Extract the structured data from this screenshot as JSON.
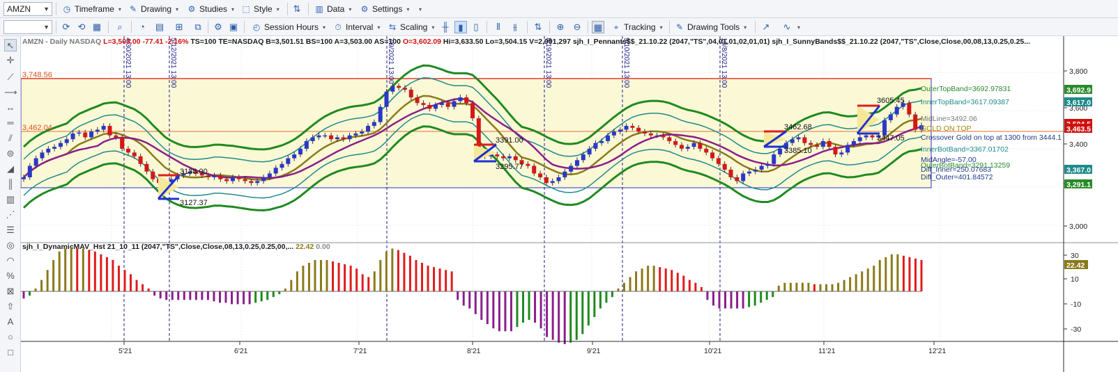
{
  "toolbar1": {
    "symbol": "AMZN",
    "items": [
      {
        "label": "Timeframe",
        "icon": "clock-icon"
      },
      {
        "label": "Drawing",
        "icon": "pencil-icon"
      },
      {
        "label": "Studies",
        "icon": "gear-icon"
      },
      {
        "label": "Style",
        "icon": "style-icon"
      },
      {
        "label": "Data",
        "icon": "bar-chart-icon"
      },
      {
        "label": "Settings",
        "icon": "settings-icon"
      }
    ]
  },
  "toolbar2": {
    "interval_value": "",
    "items": [
      {
        "label": "Session Hours",
        "icon": "session-icon"
      },
      {
        "label": "Interval",
        "icon": "interval-icon"
      },
      {
        "label": "Scaling",
        "icon": "scaling-icon"
      },
      {
        "label": "Tracking",
        "icon": "tracking-icon"
      },
      {
        "label": "Drawing Tools",
        "icon": "drawing-tools-icon"
      }
    ]
  },
  "price_header": {
    "symbol_text": "AMZN - Daily  NASDAQ",
    "last": "L=3,503.00",
    "change": "-77.41",
    "change_pct": "-2.16%",
    "rest": "TS=100  TE=NASDAQ  B=3,501.51  BS=100  A=3,503.00  AS=100",
    "open": "O=3,602.09",
    "ohlc_rest": "Hi=3,633.50  Lo=3,504.15  V=2,991,297",
    "study1": "sjh_I_Pennants$$_21.10.22 (2047,\"TS\",04,01,01,02,01,01)",
    "study2": "sjh_I_SunnyBands$$_21.10.22 (2047,\"TS\",Close,Close,00,08,13,0.25,0.25..."
  },
  "indicator_header": {
    "name": "sjh_I_DynamicMAV_Hst 21_10_11 (2047,\"TS\",Close,Close,08,13,0.25,0.25,00,...",
    "v1": "22.42",
    "v2": "0.00"
  },
  "levels": {
    "top": "3,748.56",
    "mid": "3,462.04"
  },
  "vlines": [
    "4/30/2021 13:00",
    "5/12/2021 13:00",
    "7/9/2021 13:00",
    "8/19/2021 13:00",
    "9/10/2021 13:00",
    "10/8/2021 13:00"
  ],
  "price_labels": [
    {
      "text": "3138.00"
    },
    {
      "text": "3127.37"
    },
    {
      "text": "3391.00"
    },
    {
      "text": "3295.77"
    },
    {
      "text": "3462.68"
    },
    {
      "text": "3385.10"
    },
    {
      "text": "3447.05"
    },
    {
      "text": "3605.45"
    }
  ],
  "right_labels": [
    {
      "text": "OuterTopBand=3692.97831",
      "color": "#2a8a2a"
    },
    {
      "text": "InnerTopBand=3617.09387",
      "color": "#1f8a8a"
    },
    {
      "text": "MidLine=3492.06",
      "color": "#777777"
    },
    {
      "text": "GOLD ON TOP",
      "color": "#a08a10"
    },
    {
      "text": "Crossover Gold on top at 1300 from 3444.1",
      "color": "#1e3a8a"
    },
    {
      "text": "InnerBotBand=3367.01702",
      "color": "#1f8a8a"
    },
    {
      "text": "MidAngle=-57.00",
      "color": "#1e3a8a"
    },
    {
      "text": "OuterBotBand=3291.13259",
      "color": "#2a8a2a"
    },
    {
      "text": "Diff_Inner=250.07683",
      "color": "#1e3a8a"
    },
    {
      "text": "Diff_Outer=401.84572",
      "color": "#1e3a8a"
    }
  ],
  "price_axis": [
    "3,800",
    "3,600",
    "3,400",
    "3,200",
    "3,000"
  ],
  "price_tags": [
    {
      "text": "3,692.9",
      "color": "#2a8a2a"
    },
    {
      "text": "3,617.0",
      "color": "#1f8a8a"
    },
    {
      "text": "3,504.5",
      "color": "#d01010"
    },
    {
      "text": "3,463.5",
      "color": "#d01010"
    },
    {
      "text": "3,367.0",
      "color": "#1f8a8a"
    },
    {
      "text": "3,291.1",
      "color": "#2a8a2a"
    }
  ],
  "ind_axis": [
    "30",
    "10",
    "-10",
    "-30"
  ],
  "ind_tag": {
    "text": "22.42",
    "color": "#8a7a1a"
  },
  "x_axis": [
    "5'21",
    "6'21",
    "7'21",
    "8'21",
    "9'21",
    "10'21",
    "11'21",
    "12'21"
  ],
  "chart_data": {
    "type": "candlestick",
    "ylim": [
      2920,
      3840
    ],
    "close_last": 3503.0,
    "closes": [
      3230,
      3290,
      3330,
      3360,
      3380,
      3390,
      3410,
      3430,
      3460,
      3465,
      3440,
      3470,
      3480,
      3500,
      3450,
      3440,
      3380,
      3360,
      3340,
      3300,
      3260,
      3220,
      3200,
      3190,
      3220,
      3240,
      3250,
      3260,
      3250,
      3240,
      3230,
      3240,
      3220,
      3210,
      3230,
      3220,
      3210,
      3200,
      3210,
      3230,
      3250,
      3280,
      3300,
      3330,
      3350,
      3380,
      3420,
      3440,
      3450,
      3450,
      3430,
      3440,
      3430,
      3450,
      3460,
      3470,
      3500,
      3520,
      3600,
      3680,
      3710,
      3700,
      3690,
      3650,
      3620,
      3610,
      3590,
      3610,
      3620,
      3600,
      3630,
      3650,
      3620,
      3540,
      3360,
      3340,
      3350,
      3340,
      3330,
      3340,
      3320,
      3300,
      3290,
      3250,
      3230,
      3200,
      3210,
      3230,
      3260,
      3290,
      3320,
      3350,
      3380,
      3410,
      3420,
      3450,
      3470,
      3480,
      3500,
      3490,
      3470,
      3460,
      3450,
      3450,
      3440,
      3420,
      3400,
      3380,
      3390,
      3410,
      3380,
      3360,
      3330,
      3300,
      3270,
      3230,
      3210,
      3250,
      3260,
      3270,
      3290,
      3300,
      3350,
      3380,
      3410,
      3430,
      3440,
      3410,
      3400,
      3390,
      3420,
      3390,
      3350,
      3360,
      3400,
      3420,
      3440,
      3450,
      3440,
      3450,
      3530,
      3560,
      3600,
      3620,
      3560,
      3480,
      3503
    ],
    "histogram": [
      -5,
      -3,
      2,
      8,
      15,
      22,
      28,
      30,
      31,
      30,
      30,
      29,
      28,
      26,
      24,
      22,
      18,
      15,
      12,
      8,
      5,
      2,
      -3,
      -5,
      -6,
      -6,
      -6,
      -6,
      -6,
      -6,
      -6,
      -6,
      -7,
      -8,
      -8,
      -9,
      -9,
      -9,
      -9,
      -8,
      -7,
      -6,
      -4,
      -2,
      2,
      8,
      14,
      18,
      20,
      22,
      22,
      22,
      21,
      20,
      19,
      18,
      16,
      12,
      10,
      14,
      22,
      28,
      30,
      29,
      27,
      25,
      22,
      20,
      18,
      17,
      16,
      15,
      14,
      -6,
      -10,
      -12,
      -16,
      -20,
      -23,
      -26,
      -28,
      -28,
      -28,
      -25,
      -22,
      -20,
      -22,
      -26,
      -32,
      -34,
      -36,
      -37,
      -36,
      -34,
      -30,
      -24,
      -18,
      -12,
      -8,
      -4,
      2,
      6,
      10,
      14,
      16,
      18,
      18,
      17,
      16,
      15,
      13,
      11,
      8,
      6,
      3,
      -6,
      -10,
      -12,
      -12,
      -12,
      -12,
      -12,
      -11,
      -10,
      -8,
      -6,
      -4,
      4,
      6,
      6,
      6,
      6,
      6,
      5,
      5,
      5,
      5,
      6,
      8,
      10,
      12,
      14,
      16,
      18,
      22,
      24,
      26,
      26,
      25,
      24,
      23,
      22
    ]
  }
}
